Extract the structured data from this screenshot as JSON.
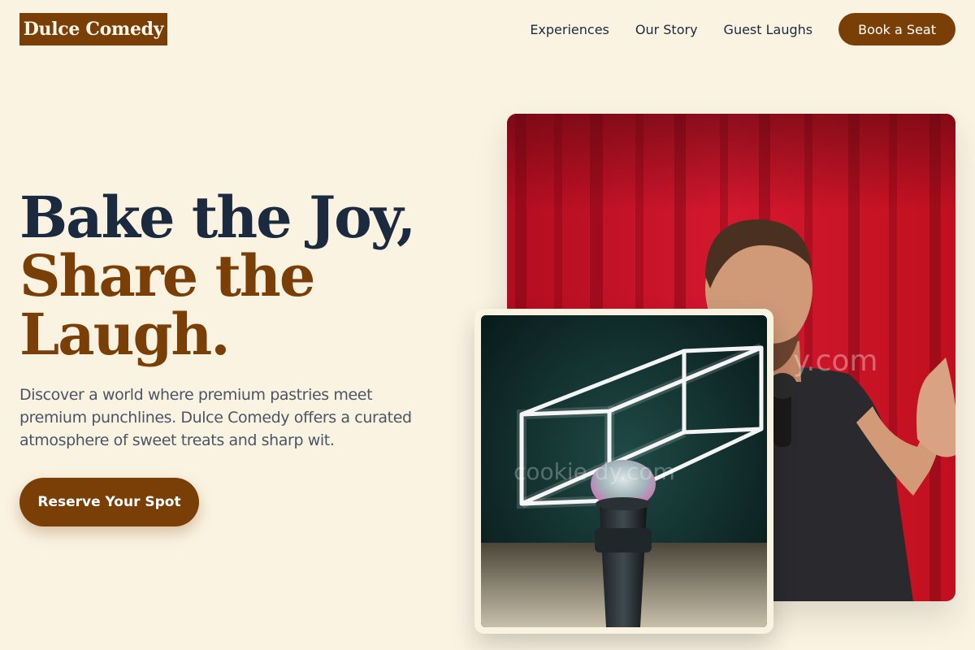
{
  "brand": {
    "name": "Dulce Comedy"
  },
  "nav": {
    "links": [
      "Experiences",
      "Our Story",
      "Guest Laughs"
    ],
    "cta": "Book a Seat"
  },
  "hero": {
    "line1": "Bake the Joy,",
    "line2": "Share the",
    "line3": "Laugh.",
    "lead": "Discover a world where premium pastries meet premium punchlines. Dulce Comedy offers a curated atmosphere of sweet treats and sharp wit.",
    "cta": "Reserve Your Spot"
  },
  "images": {
    "main_watermark": "y.com",
    "small_watermark": "cookie  dy.com"
  },
  "colors": {
    "background": "#fbf3e2",
    "brand_brown": "#7a3f06",
    "navy": "#1c2a40",
    "curtain_red": "#b30f22"
  }
}
